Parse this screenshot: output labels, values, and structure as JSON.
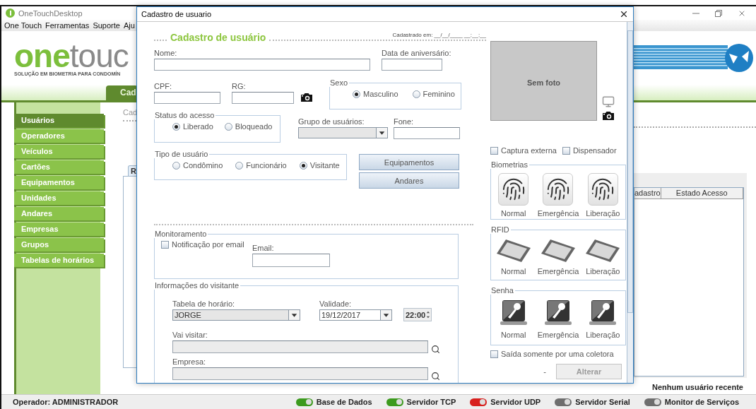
{
  "app": {
    "title": "OneTouchDesktop",
    "menu": [
      "One Touch",
      "Ferramentas",
      "Suporte",
      "Aju"
    ],
    "logo": {
      "primary": "one",
      "secondary": "touc",
      "tagline": "SOLUÇÃO EM BIOMETRIA PARA CONDOMÍN"
    },
    "tab": "Cad",
    "sidebar": [
      {
        "label": "Usuários",
        "selected": true
      },
      {
        "label": "Operadores",
        "selected": false
      },
      {
        "label": "Veículos",
        "selected": false
      },
      {
        "label": "Cartões",
        "selected": false
      },
      {
        "label": "Equipamentos",
        "selected": false
      },
      {
        "label": "Unidades",
        "selected": false
      },
      {
        "label": "Andares",
        "selected": false
      },
      {
        "label": "Empresas",
        "selected": false
      },
      {
        "label": "Grupos",
        "selected": false
      },
      {
        "label": "Tabelas de horários",
        "selected": false
      }
    ],
    "section_title": "Cad",
    "panel_tab": "R",
    "table_columns": [
      "adastro",
      "Estado Acesso"
    ],
    "recent": "Nenhum usuário recente",
    "status_bar": {
      "operator": "Operador: ADMINISTRADOR",
      "services": [
        {
          "label": "Base de Dados",
          "color": "#3c9a1e"
        },
        {
          "label": "Servidor TCP",
          "color": "#3c9a1e"
        },
        {
          "label": "Servidor UDP",
          "color": "#d8201e"
        },
        {
          "label": "Servidor Serial",
          "color": "#6e6e6e"
        },
        {
          "label": "Monitor de Serviços",
          "color": "#6e6e6e"
        }
      ]
    }
  },
  "dialog": {
    "title": "Cadastro de usuario",
    "heading": "Cadastro de usuário",
    "registered": "Cadastrado em: __/__/____ __:__:__",
    "nome": {
      "label": "Nome:"
    },
    "aniversario": {
      "label": "Data de aniversário:"
    },
    "cpf": {
      "label": "CPF:"
    },
    "rg": {
      "label": "RG:"
    },
    "sexo": {
      "title": "Sexo",
      "options": [
        {
          "label": "Masculino",
          "selected": true
        },
        {
          "label": "Feminino",
          "selected": false
        }
      ]
    },
    "status_acesso": {
      "title": "Status do acesso",
      "options": [
        {
          "label": "Liberado",
          "selected": true
        },
        {
          "label": "Bloqueado",
          "selected": false
        }
      ]
    },
    "grupo": {
      "label": "Grupo de usuários:"
    },
    "fone": {
      "label": "Fone:"
    },
    "tipo": {
      "title": "Tipo de usuário",
      "options": [
        {
          "label": "Condômino",
          "selected": false
        },
        {
          "label": "Funcionário",
          "selected": false
        },
        {
          "label": "Visitante",
          "selected": true
        }
      ]
    },
    "buttons": [
      "Equipamentos",
      "Andares"
    ],
    "monitoramento": {
      "title": "Monitoramento",
      "notify": {
        "label": "Notificação por email",
        "checked": false
      },
      "email_label": "Email:"
    },
    "visitante": {
      "title": "Informações do visitante",
      "tabela": {
        "label": "Tabela de horário:",
        "value": "JORGE"
      },
      "validade": {
        "label": "Validade:",
        "value": "19/12/2017"
      },
      "hora": "22:00",
      "vai_visitar": {
        "label": "Vai visitar:"
      },
      "empresa": {
        "label": "Empresa:"
      }
    },
    "photo": {
      "text": "Sem foto"
    },
    "options": [
      {
        "label": "Captura externa",
        "checked": false
      },
      {
        "label": "Dispensador",
        "checked": false
      }
    ],
    "capture_groups": [
      {
        "title": "Biometrias",
        "kind": "fingerprint",
        "items": [
          "Normal",
          "Emergência",
          "Liberação"
        ]
      },
      {
        "title": "RFID",
        "kind": "card",
        "items": [
          "Normal",
          "Emergência",
          "Liberação"
        ]
      },
      {
        "title": "Senha",
        "kind": "key",
        "items": [
          "Normal",
          "Emergência",
          "Liberação"
        ]
      }
    ],
    "single_exit": {
      "label": "Saída somente por uma coletora",
      "checked": false
    },
    "dash": "-",
    "submit": {
      "label": "Alterar",
      "disabled": true
    }
  }
}
